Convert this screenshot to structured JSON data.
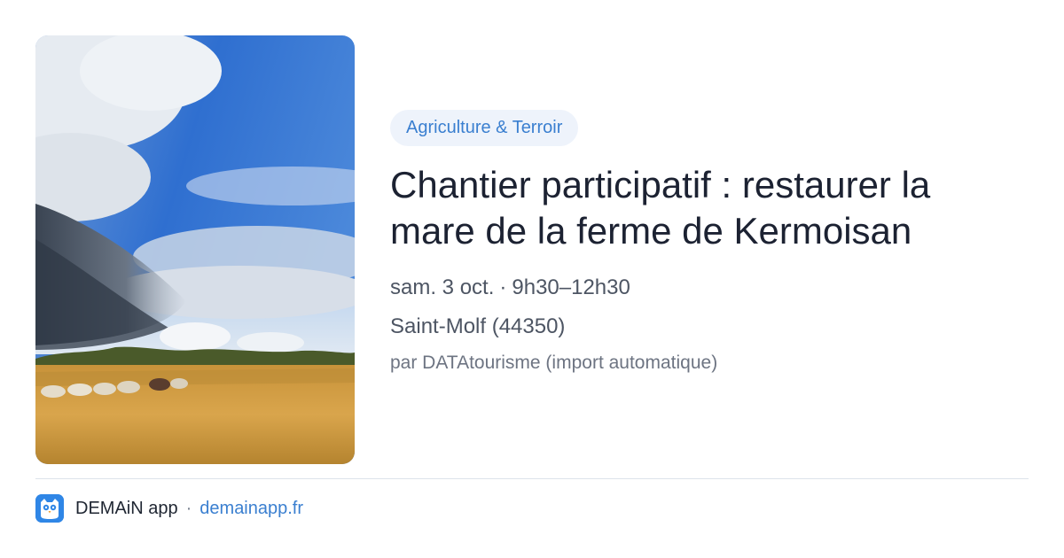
{
  "event": {
    "category": "Agriculture & Terroir",
    "title": "Chantier participatif : restaurer la mare de la ferme de Kermoisan",
    "date": "sam. 3 oct.",
    "time": "9h30–12h30",
    "location": "Saint-Molf (44350)",
    "source": "par DATAtourisme (import automatique)"
  },
  "footer": {
    "app_name": "DEMAiN app",
    "separator": "·",
    "site": "demainapp.fr"
  },
  "colors": {
    "accent": "#3a7fd0",
    "tag_background": "#eef3fb",
    "logo": "#2f86e6"
  },
  "icons": {
    "app_logo": "owl-logo-icon"
  }
}
